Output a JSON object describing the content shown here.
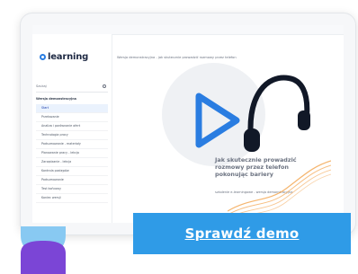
{
  "app": {
    "logo_text": "learning"
  },
  "sidebar": {
    "search_label": "Szukaj",
    "section_title": "Wersja demonstracyjna",
    "items": [
      {
        "label": "Start"
      },
      {
        "label": "Przekazanie"
      },
      {
        "label": "Analiza i porównanie ofert"
      },
      {
        "label": "Technologia pracy"
      },
      {
        "label": "Podsumowanie - materiały"
      },
      {
        "label": "Planowanie pracy - lekcja"
      },
      {
        "label": "Zarządzanie - lekcja"
      },
      {
        "label": "Kontrola postępów"
      },
      {
        "label": "Podsumowanie"
      },
      {
        "label": "Test końcowy"
      },
      {
        "label": "Koniec wersji"
      }
    ]
  },
  "main": {
    "breadcrumb": "Wersja demonstracyjna - jak skutecznie prowadzić rozmowy przez telefon",
    "headline": "Jak skutecznie prowadzić rozmowy przez telefon pokonując bariery",
    "subline": "szkolenie e-learningowe - wersja demonstracyjna"
  },
  "cta": {
    "label": "Sprawdź demo"
  },
  "colors": {
    "accent": "#2f9be7",
    "play": "#2a7de1",
    "deco": "#f3a24a"
  },
  "icons": {
    "play": "play-icon",
    "headphones": "headphones-icon",
    "search": "search-icon"
  }
}
